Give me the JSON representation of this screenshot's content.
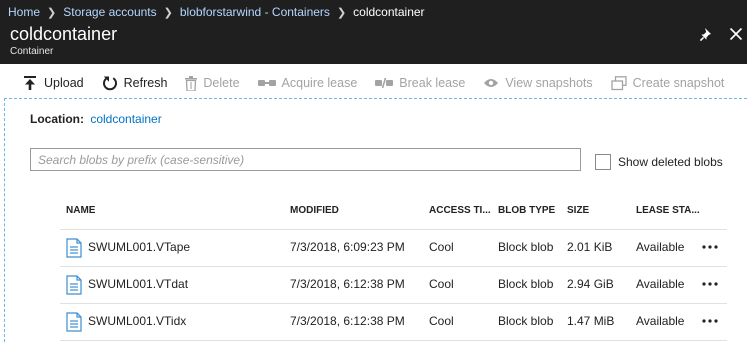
{
  "breadcrumb": [
    "Home",
    "Storage accounts",
    "blobforstarwind - Containers",
    "coldcontainer"
  ],
  "blade": {
    "title": "coldcontainer",
    "subtitle": "Container"
  },
  "commands": {
    "upload": "Upload",
    "refresh": "Refresh",
    "delete": "Delete",
    "acquire_lease": "Acquire lease",
    "break_lease": "Break lease",
    "view_snapshots": "View snapshots",
    "create_snapshot": "Create snapshot"
  },
  "location": {
    "label": "Location:",
    "value": "coldcontainer"
  },
  "search": {
    "placeholder": "Search blobs by prefix (case-sensitive)",
    "value": ""
  },
  "show_deleted": {
    "label": "Show deleted blobs",
    "checked": false
  },
  "columns": {
    "name": "NAME",
    "modified": "MODIFIED",
    "access_tier": "ACCESS TI...",
    "blob_type": "BLOB TYPE",
    "size": "SIZE",
    "lease_state": "LEASE STA..."
  },
  "rows": [
    {
      "name": "SWUML001.VTape",
      "modified": "7/3/2018, 6:09:23 PM",
      "access_tier": "Cool",
      "blob_type": "Block blob",
      "size": "2.01 KiB",
      "lease_state": "Available"
    },
    {
      "name": "SWUML001.VTdat",
      "modified": "7/3/2018, 6:12:38 PM",
      "access_tier": "Cool",
      "blob_type": "Block blob",
      "size": "2.94 GiB",
      "lease_state": "Available"
    },
    {
      "name": "SWUML001.VTidx",
      "modified": "7/3/2018, 6:12:38 PM",
      "access_tier": "Cool",
      "blob_type": "Block blob",
      "size": "1.47 MiB",
      "lease_state": "Available"
    }
  ],
  "colors": {
    "header_bg": "#1f1f1f",
    "link": "#0072c6",
    "breadcrumb_link": "#b3d7ff",
    "disabled": "#a3a3a3",
    "panel_border": "#6ab7e8",
    "file_icon": "#3e8ed0"
  }
}
